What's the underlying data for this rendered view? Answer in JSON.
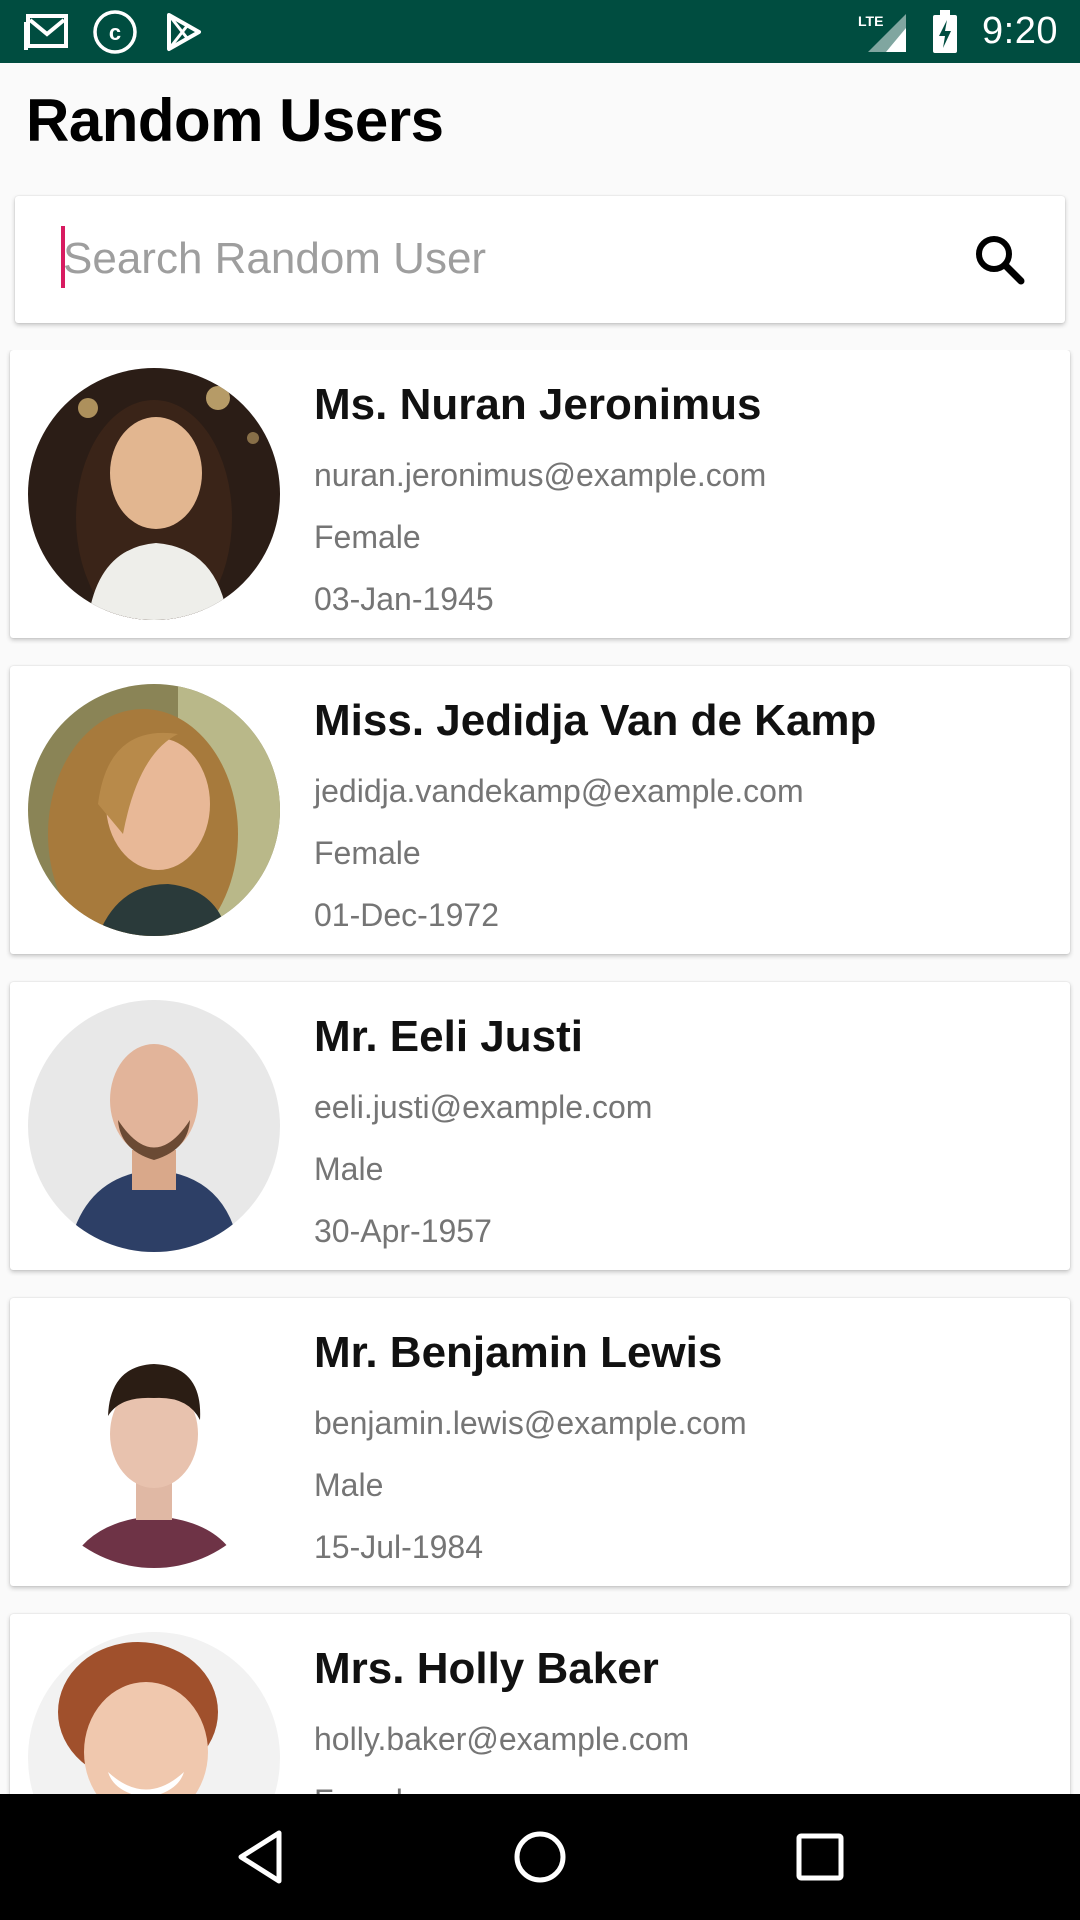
{
  "status_bar": {
    "time": "9:20",
    "left_icons": [
      "gmail-icon",
      "c-badge-icon",
      "play-store-icon"
    ],
    "right_icons": [
      "lte-signal-icon",
      "battery-charging-icon"
    ]
  },
  "header": {
    "title": "Random Users"
  },
  "search": {
    "placeholder": "Search Random User",
    "value": ""
  },
  "colors": {
    "status_bar": "#004d40",
    "cursor": "#d81b60",
    "secondary_text": "#757575"
  },
  "users": [
    {
      "name": "Ms. Nuran Jeronimus",
      "email": "nuran.jeronimus@example.com",
      "gender": "Female",
      "dob": "03-Jan-1945"
    },
    {
      "name": "Miss. Jedidja Van de Kamp",
      "email": "jedidja.vandekamp@example.com",
      "gender": "Female",
      "dob": "01-Dec-1972"
    },
    {
      "name": "Mr. Eeli Justi",
      "email": "eeli.justi@example.com",
      "gender": "Male",
      "dob": "30-Apr-1957"
    },
    {
      "name": "Mr. Benjamin Lewis",
      "email": "benjamin.lewis@example.com",
      "gender": "Male",
      "dob": "15-Jul-1984"
    },
    {
      "name": "Mrs. Holly Baker",
      "email": "holly.baker@example.com",
      "gender": "Female",
      "dob": ""
    }
  ],
  "nav_bar": {
    "buttons": [
      "back-icon",
      "home-icon",
      "recents-icon"
    ]
  }
}
